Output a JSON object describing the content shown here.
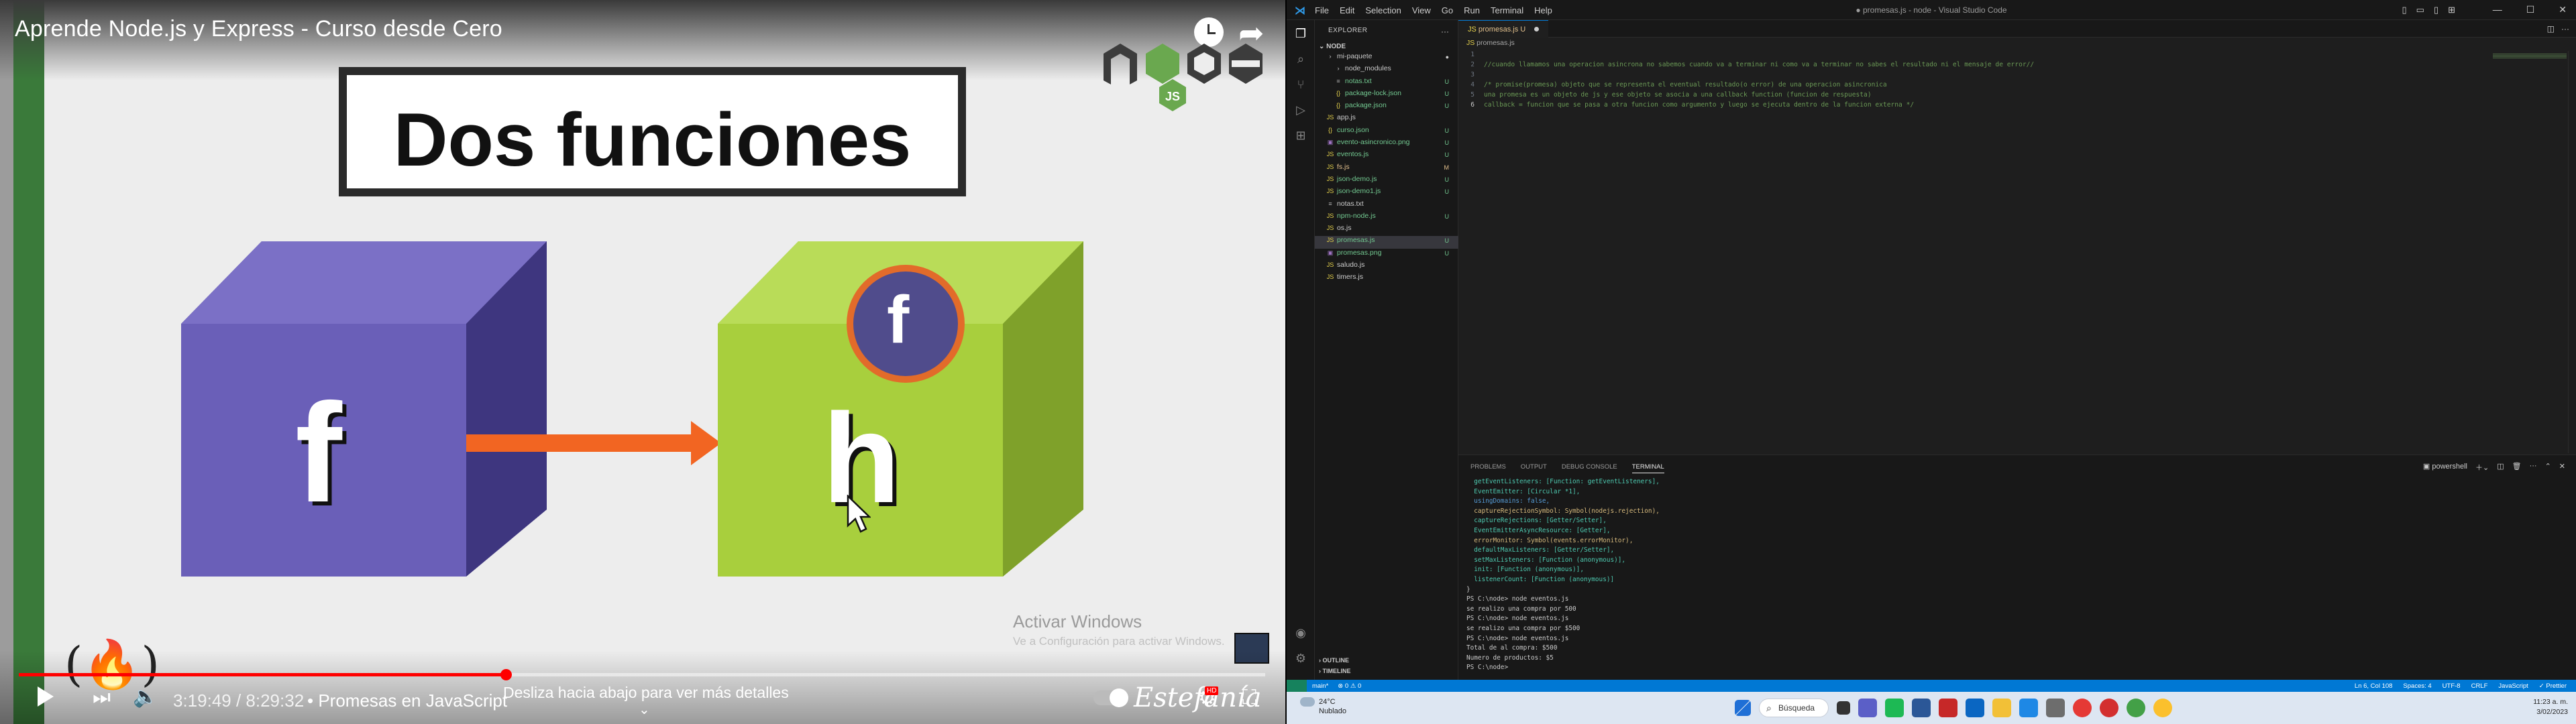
{
  "youtube": {
    "video_title": "Aprende Node.js y Express - Curso desde Cero",
    "slide_heading": "Dos funciones",
    "box_left_letter": "f",
    "box_right_letter": "h",
    "badge_letter": "f",
    "watermark_line1": "Activar Windows",
    "watermark_line2": "Ve a Configuración para activar Windows.",
    "time_display": "3:19:49 / 8:29:32",
    "chapter": "• Promesas en JavaScript",
    "swipe_hint": "Desliza hacia abajo para ver más detalles",
    "progress_fraction": 0.391,
    "signature": "Estefanía",
    "hd_badge": "HD",
    "colors": {
      "progress": "#ff0000",
      "box_left": "#6a5fb8",
      "box_right": "#9bc537",
      "arrow": "#f26522"
    }
  },
  "vscode": {
    "window_title": "● promesas.js - node - Visual Studio Code",
    "menu": [
      "File",
      "Edit",
      "Selection",
      "View",
      "Go",
      "Run",
      "Terminal",
      "Help"
    ],
    "sidebar_title": "EXPLORER",
    "project": "NODE",
    "files": [
      {
        "name": "mi-paquete",
        "icon": "folder-icon",
        "badge": "●",
        "indent": 1
      },
      {
        "name": "node_modules",
        "icon": "folder-icon",
        "badge": "",
        "indent": 2
      },
      {
        "name": "notas.txt",
        "icon": "text-icon",
        "badge": "U",
        "indent": 2
      },
      {
        "name": "package-lock.json",
        "icon": "json-icon",
        "badge": "U",
        "indent": 2
      },
      {
        "name": "package.json",
        "icon": "json-icon",
        "badge": "U",
        "indent": 2
      },
      {
        "name": "app.js",
        "icon": "js-icon",
        "badge": "",
        "indent": 1
      },
      {
        "name": "curso.json",
        "icon": "json-icon",
        "badge": "U",
        "indent": 1
      },
      {
        "name": "evento-asincronico.png",
        "icon": "image-icon",
        "badge": "U",
        "indent": 1
      },
      {
        "name": "eventos.js",
        "icon": "js-icon",
        "badge": "U",
        "indent": 1
      },
      {
        "name": "fs.js",
        "icon": "js-icon",
        "badge": "M",
        "indent": 1
      },
      {
        "name": "json-demo.js",
        "icon": "js-icon",
        "badge": "U",
        "indent": 1
      },
      {
        "name": "json-demo1.js",
        "icon": "js-icon",
        "badge": "U",
        "indent": 1
      },
      {
        "name": "notas.txt",
        "icon": "text-icon",
        "badge": "",
        "indent": 1
      },
      {
        "name": "npm-node.js",
        "icon": "js-icon",
        "badge": "U",
        "indent": 1
      },
      {
        "name": "os.js",
        "icon": "js-icon",
        "badge": "",
        "indent": 1
      },
      {
        "name": "promesas.js",
        "icon": "js-icon",
        "badge": "U",
        "indent": 1,
        "selected": true
      },
      {
        "name": "promesas.png",
        "icon": "image-icon",
        "badge": "U",
        "indent": 1
      },
      {
        "name": "saludo.js",
        "icon": "js-icon",
        "badge": "",
        "indent": 1
      },
      {
        "name": "timers.js",
        "icon": "js-icon",
        "badge": "",
        "indent": 1
      }
    ],
    "outline_label": "OUTLINE",
    "timeline_label": "TIMELINE",
    "active_tab": "promesas.js U",
    "breadcrumb": "promesas.js",
    "code_lines": [
      {
        "n": "1",
        "text": ""
      },
      {
        "n": "2",
        "text": "//cuando llamamos una operacion asincrona no sabemos cuando va a terminar ni como va a terminar no sabes el resultado ni el mensaje de error//"
      },
      {
        "n": "3",
        "text": ""
      },
      {
        "n": "4",
        "text": "/* promise(promesa) objeto que se representa el eventual resultado(o error) de una operacion asincronica"
      },
      {
        "n": "5",
        "text": "una promesa es un objeto de js y ese objeto se asocia a una callback function (funcion de respuesta)"
      },
      {
        "n": "6",
        "text": "callback = funcion que se pasa a otra funcion como argumento y luego se ejecuta dentro de la funcion externa */",
        "current": true
      }
    ],
    "panel_tabs": [
      "PROBLEMS",
      "OUTPUT",
      "DEBUG CONSOLE",
      "TERMINAL"
    ],
    "panel_active": "TERMINAL",
    "shell": "powershell",
    "terminal": [
      "  getEventListeners: [Function: getEventListeners],",
      "  EventEmitter: [Circular *1],",
      "  usingDomains: false,",
      "  captureRejectionSymbol: Symbol(nodejs.rejection),",
      "  captureRejections: [Getter/Setter],",
      "  EventEmitterAsyncResource: [Getter],",
      "  errorMonitor: Symbol(events.errorMonitor),",
      "  defaultMaxListeners: [Getter/Setter],",
      "  setMaxListeners: [Function (anonymous)],",
      "  init: [Function (anonymous)],",
      "  listenerCount: [Function (anonymous)]",
      "}",
      "PS C:\\node> node eventos.js",
      "se realizo una compra por 500",
      "PS C:\\node> node eventos.js",
      "se realizo una compra por $500",
      "PS C:\\node> node eventos.js",
      "Total de al compra: $500",
      "Numero de productos: $5",
      "PS C:\\node> "
    ],
    "status_left": [
      "main*",
      "⊗ 0 ⚠ 0"
    ],
    "status_right": [
      "Ln 6, Col 108",
      "Spaces: 4",
      "UTF-8",
      "CRLF",
      "JavaScript",
      "✓ Prettier"
    ],
    "colors": {
      "statusbar": "#0078d4",
      "comment": "#6a9955"
    }
  },
  "taskbar": {
    "weather_temp": "24°C",
    "weather_desc": "Nublado",
    "search_label": "Búsqueda",
    "time": "11:23 a. m.",
    "date": "3/02/2023"
  }
}
